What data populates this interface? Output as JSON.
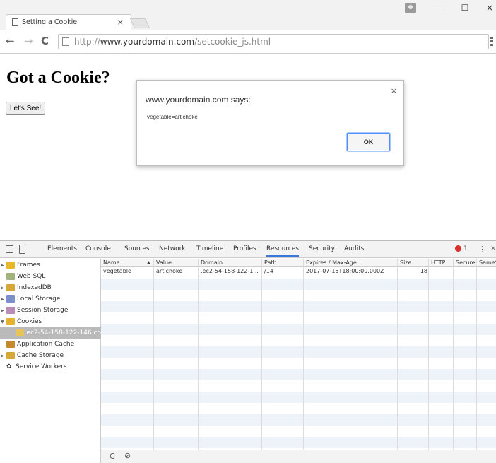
{
  "browser": {
    "tab_title": "Setting a Cookie",
    "tab_close": "×",
    "url_protocol": "http://",
    "url_host": "www.yourdomain.com",
    "url_path": "/setcookie_js.html",
    "win_minimize": "–",
    "win_maximize": "☐",
    "win_close": "×",
    "back": "←",
    "forward": "→",
    "reload": "C"
  },
  "page": {
    "heading": "Got a Cookie?",
    "button": "Let's See!"
  },
  "dialog": {
    "title": "www.yourdomain.com says:",
    "message": "vegetable=artichoke",
    "ok": "OK",
    "close": "×"
  },
  "devtools": {
    "tabs": [
      "Elements",
      "Console",
      "Sources",
      "Network",
      "Timeline",
      "Profiles",
      "Resources",
      "Security",
      "Audits"
    ],
    "active_tab": "Resources",
    "error_count": "1",
    "kebab": "⋮",
    "close": "×",
    "sidebar": [
      {
        "label": "Frames",
        "icon": "folder-icon",
        "color": "#e7b92a",
        "expandable": true
      },
      {
        "label": "Web SQL",
        "icon": "database-icon",
        "color": "#a3b37d",
        "expandable": false
      },
      {
        "label": "IndexedDB",
        "icon": "database-icon",
        "color": "#d6a83a",
        "expandable": true
      },
      {
        "label": "Local Storage",
        "icon": "table-icon",
        "color": "#7b8fcc",
        "expandable": true
      },
      {
        "label": "Session Storage",
        "icon": "table-icon",
        "color": "#b98bb6",
        "expandable": true
      },
      {
        "label": "Cookies",
        "icon": "cookie-icon",
        "color": "#e2b230",
        "expandable": true,
        "expanded": true
      },
      {
        "label": "ec2-54-158-122-146.co",
        "icon": "cookie-icon",
        "color": "#e6c45b",
        "expandable": false,
        "selected": true
      },
      {
        "label": "Application Cache",
        "icon": "grid-icon",
        "color": "#c28a2c",
        "expandable": false
      },
      {
        "label": "Cache Storage",
        "icon": "database-icon",
        "color": "#d6a83a",
        "expandable": true
      },
      {
        "label": "Service Workers",
        "icon": "gear-icon",
        "color": "#333333",
        "expandable": false
      }
    ],
    "columns": [
      "Name",
      "Value",
      "Domain",
      "Path",
      "Expires / Max-Age",
      "Size",
      "HTTP",
      "Secure",
      "SameS..."
    ],
    "sort_indicator": "▲",
    "rows": [
      [
        "vegetable",
        "artichoke",
        ".ec2-54-158-122-1...",
        "/14",
        "2017-07-15T18:00:00.000Z",
        "18",
        "",
        "",
        ""
      ]
    ],
    "footer_refresh": "C",
    "footer_clear": "⊘"
  },
  "colors": {
    "accent": "#3879d9",
    "error": "#d9302c",
    "stripe": "#eef3fa"
  }
}
